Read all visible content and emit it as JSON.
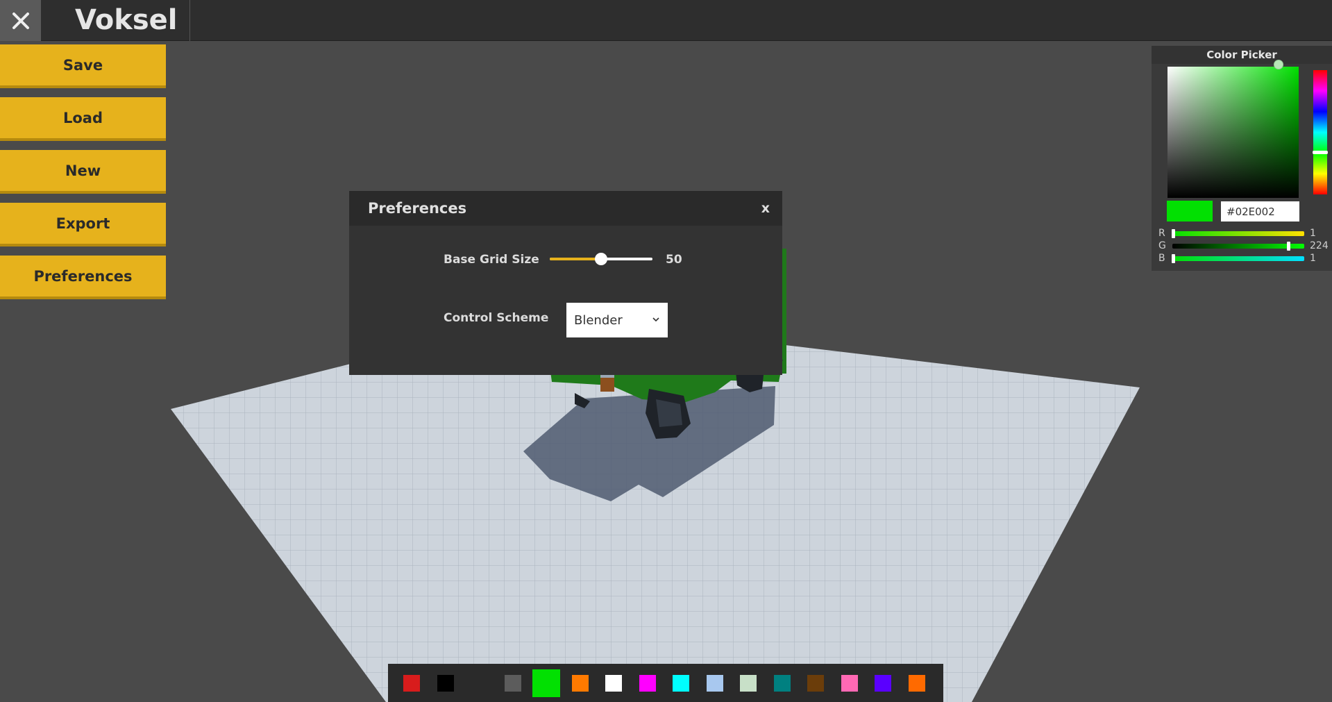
{
  "app": {
    "title": "Voksel",
    "close_icon": "close-icon"
  },
  "menu": {
    "items": [
      {
        "label": "Save"
      },
      {
        "label": "Load"
      },
      {
        "label": "New"
      },
      {
        "label": "Export"
      },
      {
        "label": "Preferences"
      }
    ],
    "accent": "#e6b21c"
  },
  "preferences": {
    "title": "Preferences",
    "close_label": "x",
    "base_grid_size": {
      "label": "Base Grid Size",
      "value": "50",
      "fraction": 0.5
    },
    "control_scheme": {
      "label": "Control Scheme",
      "selected": "Blender",
      "icon": "chevron-down-icon"
    }
  },
  "color_picker": {
    "title": "Color Picker",
    "hex": "#02E002",
    "current_color": "#02e002",
    "channels": [
      {
        "label": "R",
        "value": "1"
      },
      {
        "label": "G",
        "value": "224"
      },
      {
        "label": "B",
        "value": "1"
      }
    ]
  },
  "palette": {
    "selected_index": 4,
    "colors": [
      "#d81c1c",
      "#000000",
      "#2a2a2a",
      "#5c5c5c",
      "#02e002",
      "#ff7a00",
      "#ffffff",
      "#ff00ff",
      "#00ffff",
      "#a8c8ef",
      "#c8e0c8",
      "#008080",
      "#6b3d0a",
      "#ff69b4",
      "#5a00ff",
      "#ff6a00"
    ]
  }
}
